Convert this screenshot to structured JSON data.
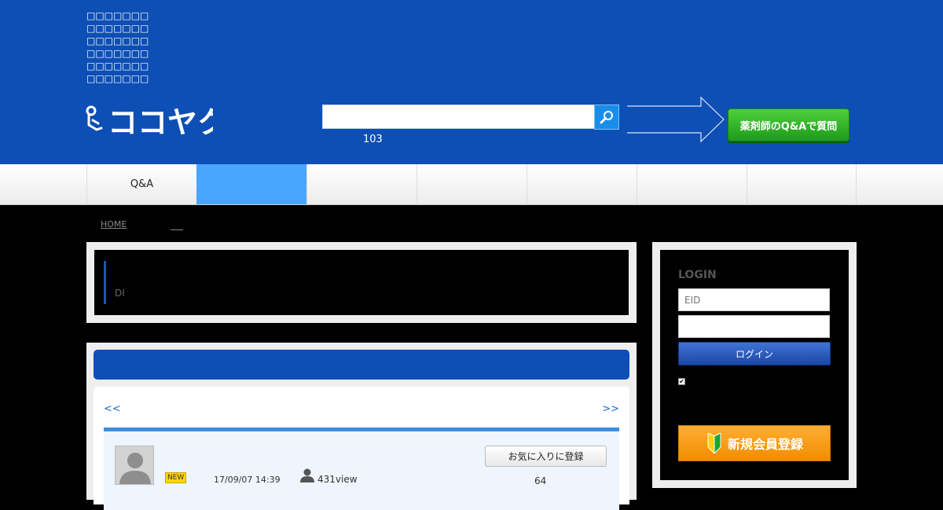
{
  "header": {
    "tagline": "□□□□□□□□□□□□□□□□□□□□□□□□□□□□□□□□□□□□□□□□□□",
    "logo_text": "ココヤク",
    "search": {
      "value": "",
      "placeholder": ""
    },
    "search_count": "103",
    "ask_button": "薬剤師のQ&Aで質問"
  },
  "nav": {
    "items": [
      {
        "label": "Q&A"
      },
      {
        "label": ""
      },
      {
        "label": ""
      },
      {
        "label": ""
      },
      {
        "label": ""
      },
      {
        "label": ""
      },
      {
        "label": ""
      }
    ]
  },
  "breadcrumb": {
    "home": "HOME"
  },
  "intro": {
    "label": "DI"
  },
  "list": {
    "title": "",
    "prev": "<<",
    "next": ">>",
    "items": [
      {
        "badge": "NEW",
        "date": "17/09/07 14:39",
        "views": "431view",
        "favorite_label": "お気に入りに登録",
        "favorite_count": "64"
      }
    ]
  },
  "login": {
    "title": "LOGIN",
    "eid_placeholder": "EID",
    "password_placeholder": "",
    "button": "ログイン",
    "register": "新規会員登録"
  },
  "colors": {
    "header_bg": "#0e4fb5",
    "nav_active": "#4aa5ff",
    "ask_green": "#2fb52a",
    "register_orange": "#f89d12"
  }
}
